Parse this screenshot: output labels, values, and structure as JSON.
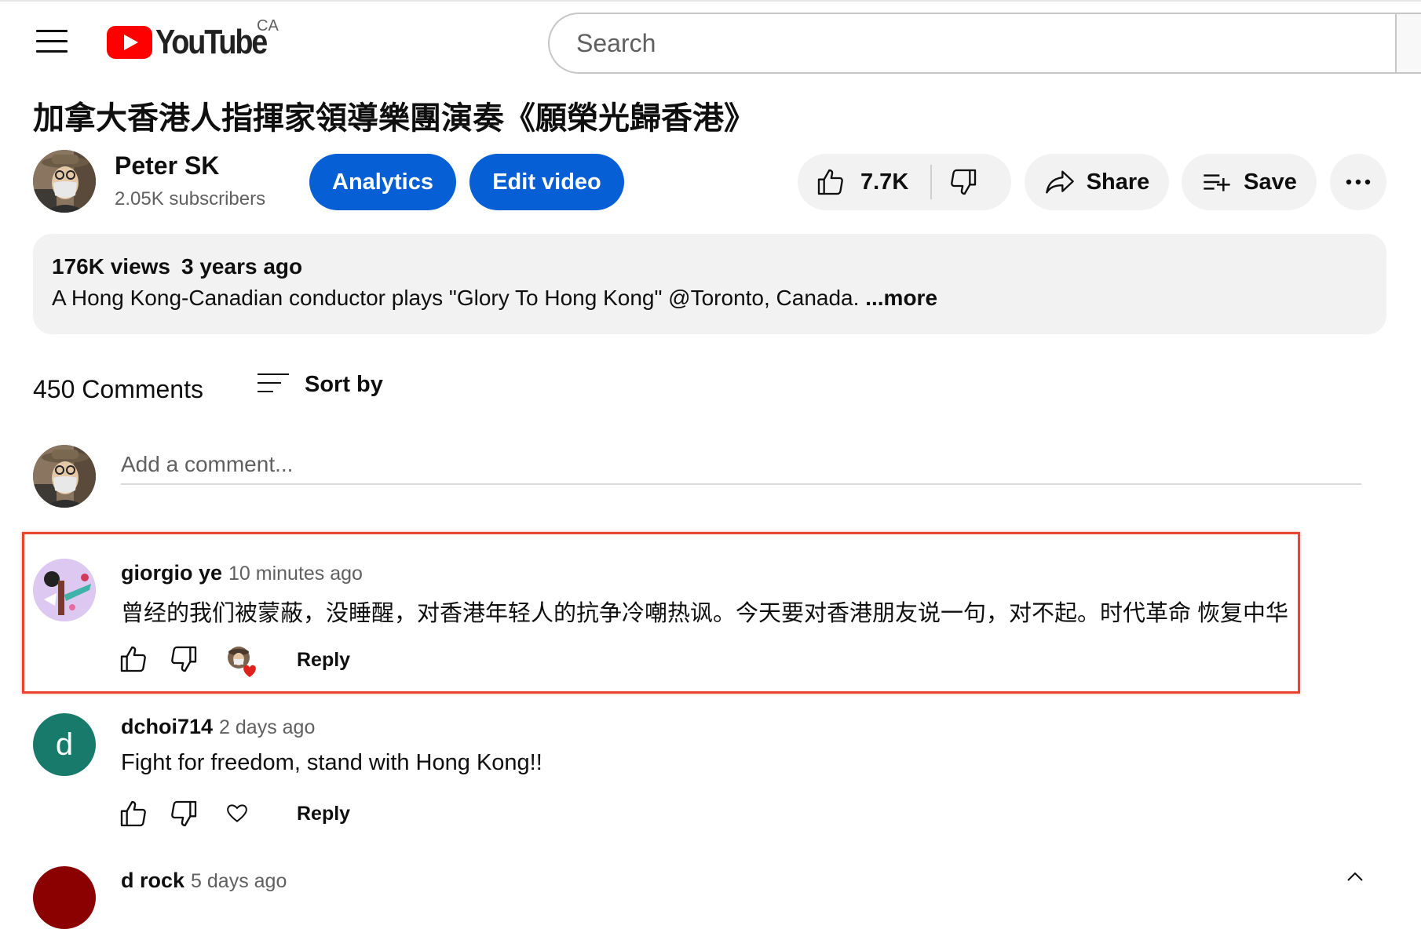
{
  "header": {
    "logo_text": "YouTube",
    "country_code": "CA",
    "search_placeholder": "Search",
    "icons": [
      "menu-icon",
      "search-icon"
    ]
  },
  "video": {
    "title": "加拿大香港人指揮家領導樂團演奏《願榮光歸香港》",
    "channel_name": "Peter SK",
    "subscribers": "2.05K subscribers",
    "analytics_label": "Analytics",
    "edit_label": "Edit video",
    "likes": "7.7K",
    "share_label": "Share",
    "save_label": "Save",
    "views": "176K views",
    "age": "3 years ago",
    "description": "A Hong Kong-Canadian conductor plays \"Glory To Hong Kong\" @Toronto, Canada.",
    "more_label": "...more"
  },
  "comments_section": {
    "count_label": "450 Comments",
    "sort_label": "Sort by",
    "add_placeholder": "Add a comment..."
  },
  "comments": [
    {
      "author": "giorgio ye",
      "time": "10 minutes ago",
      "text": "曾经的我们被蒙蔽，没睡醒，对香港年轻人的抗争冷嘲热讽。今天要对香港朋友说一句，对不起。时代革命 恢复中华",
      "reply_label": "Reply",
      "creator_hearted": true
    },
    {
      "author": "dchoi714",
      "avatar_letter": "d",
      "time": "2 days ago",
      "text": "Fight for freedom, stand with Hong Kong!!",
      "reply_label": "Reply",
      "creator_hearted": false
    },
    {
      "author": "d rock",
      "time": "5 days ago"
    }
  ],
  "colors": {
    "accent_blue": "#065fd4",
    "youtube_red": "#ff0000",
    "highlight_border": "#e8452f",
    "pill_bg": "#f2f2f2",
    "dchoi_avatar": "#177a6b",
    "drock_avatar": "#8b0000"
  }
}
